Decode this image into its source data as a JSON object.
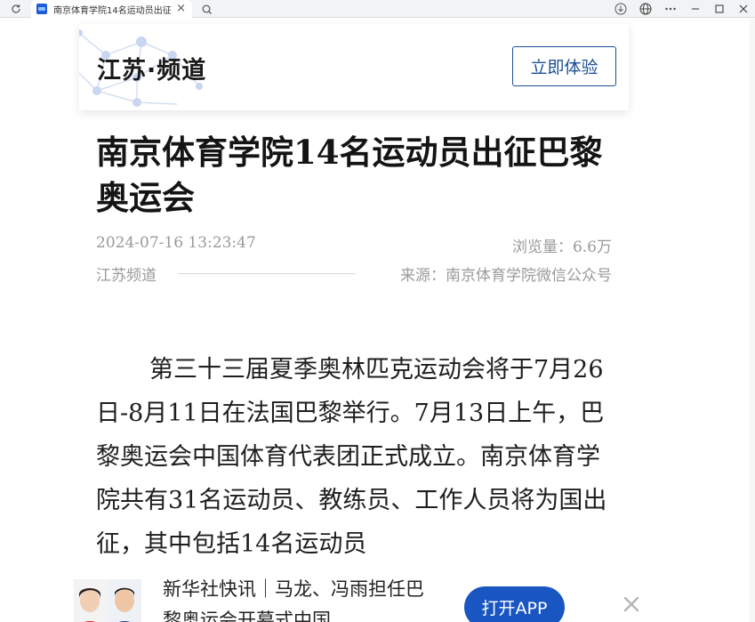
{
  "browser": {
    "tab_title": "南京体育学院14名运动员出征巴黎奥运会",
    "tab_close": "×"
  },
  "header": {
    "channel_title": "江苏·频道",
    "try_button": "立即体验"
  },
  "article": {
    "headline": "南京体育学院14名运动员出征巴黎奥运会",
    "datetime": "2024-07-16 13:23:47",
    "views": "浏览量：6.6万",
    "channel": "江苏频道",
    "source": "来源：南京体育学院微信公众号",
    "body": "第三十三届夏季奥林匹克运动会将于7月26日-8月11日在法国巴黎举行。7月13日上午，巴黎奥运会中国体育代表团正式成立。南京体育学院共有31名运动员、教练员、工作人员将为国出征，其中包括14名运动员"
  },
  "bottom_banner": {
    "news_snippet": "新华社快讯｜马龙、冯雨担任巴黎奥运会开幕式中国…",
    "open_app_button": "打开APP",
    "colors": {
      "button": "#1a56c2"
    }
  },
  "colors": {
    "accent": "#1b4f96",
    "meta": "#9a9a9a"
  }
}
